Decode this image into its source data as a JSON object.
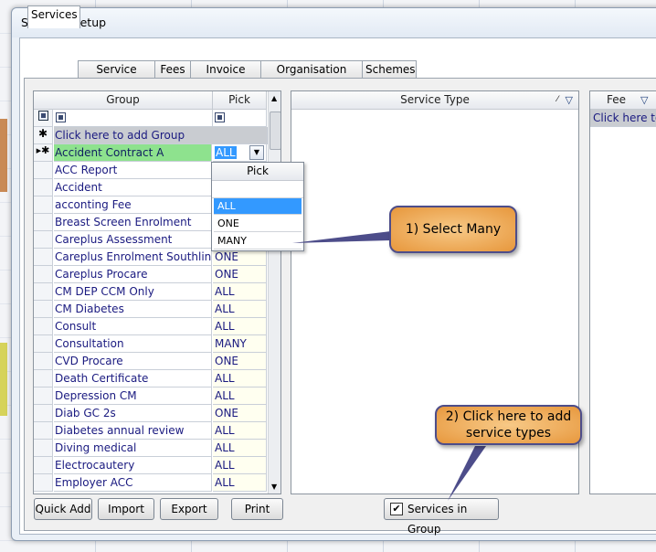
{
  "window": {
    "title": "Services Setup"
  },
  "tabs": [
    {
      "label": "Services"
    },
    {
      "label": "Service Types"
    },
    {
      "label": "Fees"
    },
    {
      "label": "Invoice Type"
    },
    {
      "label": "Organisation Types"
    },
    {
      "label": "Schemes"
    }
  ],
  "group_grid": {
    "headers": {
      "group": "Group",
      "pick": "Pick"
    },
    "add_row": "Click here to add Group",
    "current_row": {
      "group": "Accident Contract A",
      "pick": "ALL"
    },
    "rows": [
      {
        "group": "ACC Report",
        "pick": ""
      },
      {
        "group": "Accident",
        "pick": ""
      },
      {
        "group": "acconting Fee",
        "pick": ""
      },
      {
        "group": "Breast Screen Enrolment",
        "pick": ""
      },
      {
        "group": "Careplus Assessment",
        "pick": ""
      },
      {
        "group": "Careplus Enrolment Southlink",
        "pick": "ONE"
      },
      {
        "group": "Careplus Procare",
        "pick": "ONE"
      },
      {
        "group": "CM DEP CCM Only",
        "pick": "ALL"
      },
      {
        "group": "CM Diabetes",
        "pick": "ALL"
      },
      {
        "group": "Consult",
        "pick": "ALL"
      },
      {
        "group": "Consultation",
        "pick": "MANY"
      },
      {
        "group": "CVD Procare",
        "pick": "ONE"
      },
      {
        "group": "Death Certificate",
        "pick": "ALL"
      },
      {
        "group": "Depression CM",
        "pick": "ALL"
      },
      {
        "group": "Diab GC 2s",
        "pick": "ONE"
      },
      {
        "group": "Diabetes annual review",
        "pick": "ALL"
      },
      {
        "group": "Diving medical",
        "pick": "ALL"
      },
      {
        "group": "Electrocautery",
        "pick": "ALL"
      },
      {
        "group": "Employer ACC",
        "pick": "ALL"
      }
    ]
  },
  "pick_dropdown": {
    "header": "Pick",
    "options": [
      {
        "label": "ALL",
        "selected": true
      },
      {
        "label": "ONE"
      },
      {
        "label": "MANY"
      }
    ]
  },
  "service_type_grid": {
    "header": "Service Type"
  },
  "fee_grid": {
    "header": "Fee",
    "add_row": "Click here to"
  },
  "buttons": {
    "quick_add": "Quick Add",
    "import": "Import",
    "export": "Export",
    "print": "Print"
  },
  "services_in_group": {
    "label": "Services in Group",
    "checked": true
  },
  "callouts": {
    "select_many": "1) Select Many",
    "add_service_types": "2) Click here to add service types"
  },
  "colors": {
    "selected_row": "#8ee28e",
    "pick_cell": "#fffff0",
    "highlight": "#3399ff",
    "callout": "#efb066"
  }
}
